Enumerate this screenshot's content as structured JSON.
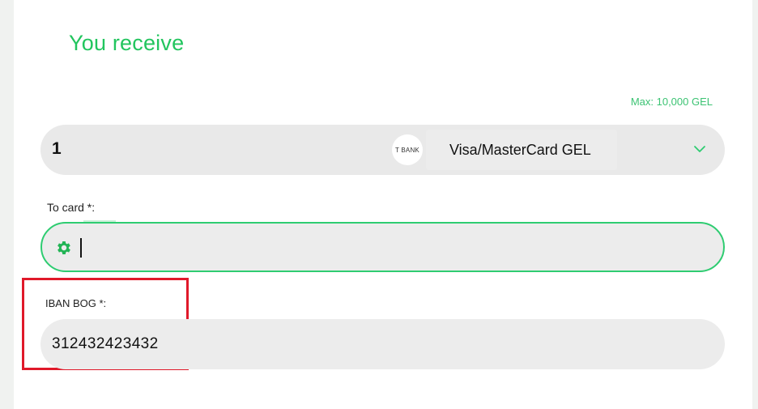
{
  "section": {
    "title": "You receive"
  },
  "limits": {
    "max_label": "Max: 10,000 GEL"
  },
  "amount": {
    "value": "1",
    "bank_logo_text": "T BANK",
    "currency": "Visa/MasterCard GEL"
  },
  "to_card": {
    "label": "To card *:",
    "value": ""
  },
  "iban": {
    "label": "IBAN BOG *:",
    "value": "312432423432"
  },
  "colors": {
    "accent": "#22c55e",
    "focus_border": "#2ecc71",
    "highlight_box": "#e0192a",
    "field_bg": "#ececec"
  },
  "icons": [
    "gear-icon",
    "chevron-down-icon"
  ]
}
